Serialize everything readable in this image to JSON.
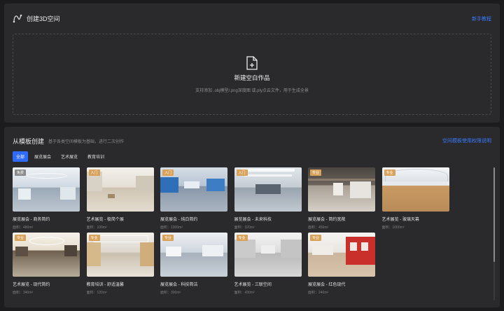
{
  "create": {
    "title": "创建3D空间",
    "guide_link": "新手教程",
    "dropzone_title": "新建空白作品",
    "dropzone_hint": "支持添加 .obj模型/.png深度图 或.ply点云文件，用于生成全景"
  },
  "templates": {
    "title": "从模板创建",
    "subtitle": "基于各类空间模板为基础，进行二次创作",
    "rights_link": "空间模板使用权限说明",
    "tabs": [
      "全部",
      "展览展会",
      "艺术展览",
      "教育培训"
    ],
    "active_tab": "全部",
    "items": [
      {
        "badge": "免费",
        "title": "展览展会 - 商务简约",
        "area": "面积：480m²"
      },
      {
        "badge": "入门",
        "title": "艺术展览 - 极简个展",
        "area": "面积：100m²"
      },
      {
        "badge": "入门",
        "title": "展览展会 - 纯白简约",
        "area": "面积：1000m²"
      },
      {
        "badge": "入门",
        "title": "展览展会 - 未来科技",
        "area": "面积：320m²"
      },
      {
        "badge": "专业",
        "title": "展览展会 - 简约宽敞",
        "area": "面积：450m²"
      },
      {
        "badge": "专业",
        "title": "艺术展览 - 玻璃天幕",
        "area": "面积：1000m²"
      },
      {
        "badge": "专业",
        "title": "艺术展览 - 现代简约",
        "area": "面积：340m²"
      },
      {
        "badge": "专业",
        "title": "教育培训 - 舒适温馨",
        "area": "面积：120m²"
      },
      {
        "badge": "专业",
        "title": "展览展会 - 科技简洁",
        "area": "面积：300m²"
      },
      {
        "badge": "专业",
        "title": "艺术展览 - 三联空间",
        "area": "面积：430m²"
      },
      {
        "badge": "专业",
        "title": "展览展会 - 红色现代",
        "area": "面积：240m²"
      }
    ]
  },
  "colors": {
    "accent": "#2f6bff",
    "badge_free": "#8a8a8a",
    "badge_basic": "#d9a25a",
    "badge_pro": "#d9a25a"
  },
  "icons": {
    "create_header": "curve-path-icon",
    "new_file": "file-plus-icon"
  }
}
